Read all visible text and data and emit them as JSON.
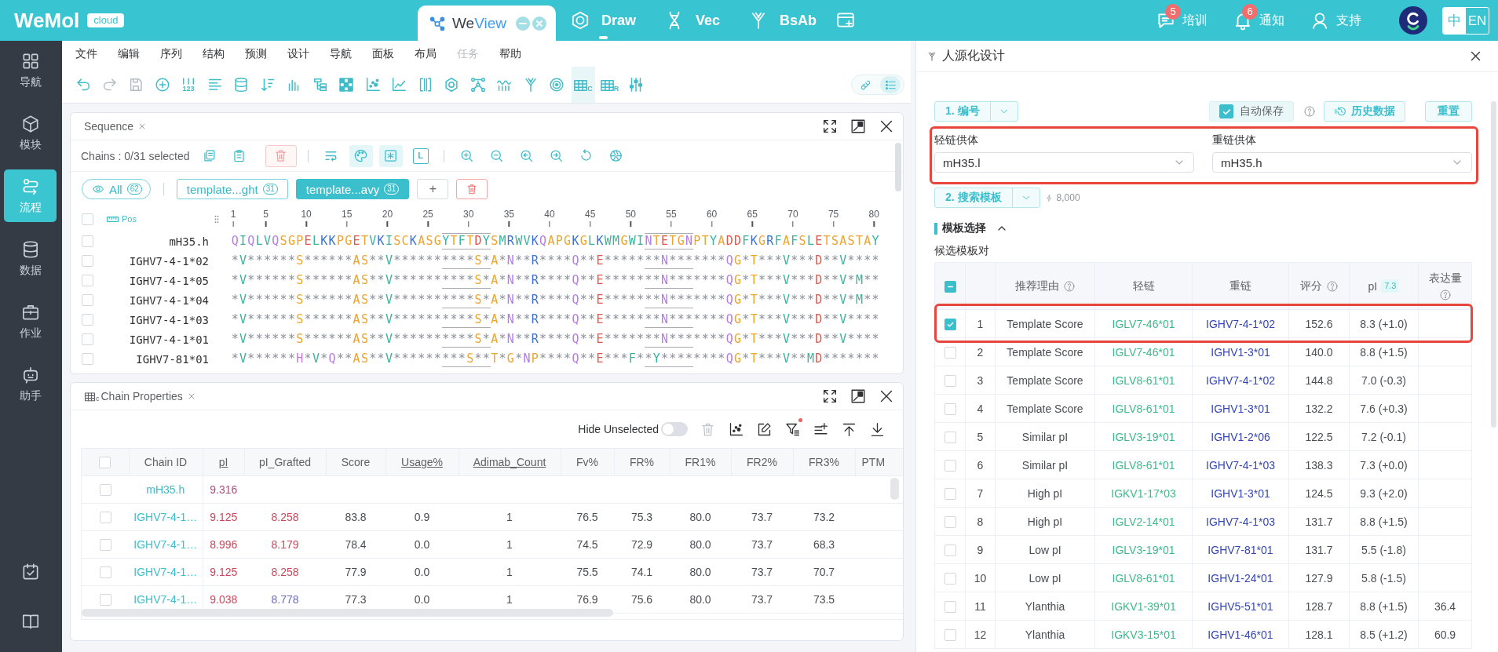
{
  "top_bar": {
    "logo": "WeMol",
    "edition": "cloud",
    "tabs": [
      {
        "label_parts": [
          "We",
          "View"
        ],
        "selected": true,
        "indicator": false
      },
      {
        "label_parts": [
          "Draw"
        ],
        "selected": false,
        "indicator": true
      },
      {
        "label_parts": [
          "Vec"
        ],
        "selected": false,
        "indicator": false
      },
      {
        "label_parts": [
          "BsAb"
        ],
        "selected": false,
        "indicator": false
      }
    ],
    "links": [
      {
        "label": "培训",
        "badge": "5"
      },
      {
        "label": "通知",
        "badge": "6"
      },
      {
        "label": "支持"
      }
    ],
    "languages": [
      {
        "label": "中",
        "selected": true
      },
      {
        "label": "EN",
        "selected": false
      }
    ]
  },
  "sidebar": {
    "items": [
      {
        "label": "导航",
        "selected": false
      },
      {
        "label": "模块",
        "selected": false
      },
      {
        "label": "流程",
        "selected": true
      },
      {
        "label": "数据",
        "selected": false
      },
      {
        "label": "作业",
        "selected": false
      },
      {
        "label": "助手",
        "selected": false
      }
    ]
  },
  "menu": [
    {
      "label": "文件",
      "disabled": false
    },
    {
      "label": "编辑",
      "disabled": false
    },
    {
      "label": "序列",
      "disabled": false
    },
    {
      "label": "结构",
      "disabled": false
    },
    {
      "label": "预测",
      "disabled": false
    },
    {
      "label": "设计",
      "disabled": false
    },
    {
      "label": "导航",
      "disabled": false
    },
    {
      "label": "面板",
      "disabled": false
    },
    {
      "label": "布局",
      "disabled": false
    },
    {
      "label": "任务",
      "disabled": true
    },
    {
      "label": "帮助",
      "disabled": false
    }
  ],
  "toolbar": {
    "tools": [
      {
        "disabled": false,
        "selected": false
      },
      {
        "disabled": true,
        "selected": false
      },
      {
        "disabled": true,
        "selected": false
      },
      {
        "disabled": false,
        "selected": false
      },
      {
        "disabled": false,
        "selected": false,
        "sub": "123"
      },
      {
        "disabled": false,
        "selected": false
      },
      {
        "disabled": false,
        "selected": false
      },
      {
        "disabled": false,
        "selected": false
      },
      {
        "disabled": false,
        "selected": false
      },
      {
        "disabled": false,
        "selected": false
      },
      {
        "disabled": false,
        "selected": false
      },
      {
        "disabled": false,
        "selected": false
      },
      {
        "disabled": false,
        "selected": false
      },
      {
        "disabled": false,
        "selected": false
      },
      {
        "disabled": false,
        "selected": false
      },
      {
        "disabled": false,
        "selected": false
      },
      {
        "disabled": false,
        "selected": false
      },
      {
        "disabled": false,
        "selected": false
      },
      {
        "disabled": false,
        "selected": false
      },
      {
        "disabled": false,
        "selected": true,
        "sub": "C"
      },
      {
        "disabled": false,
        "selected": false,
        "sub": "R"
      },
      {
        "disabled": false,
        "selected": false
      }
    ],
    "view_modes": [
      {
        "selected": false
      },
      {
        "selected": true
      }
    ]
  },
  "sequence_panel": {
    "title": "Sequence",
    "selection_info": "Chains : 0/31 selected",
    "tools": [
      {
        "kind": "icon",
        "selected": false,
        "disabled": false
      },
      {
        "kind": "icon",
        "selected": false,
        "disabled": false
      },
      {
        "kind": "danger",
        "selected": false,
        "disabled": true
      },
      {
        "kind": "icon",
        "selected": false,
        "disabled": false
      },
      {
        "kind": "icon",
        "selected": true,
        "disabled": false
      },
      {
        "kind": "icon",
        "selected": true,
        "disabled": false
      },
      {
        "kind": "letter",
        "label": "L",
        "selected": false,
        "disabled": false
      },
      {
        "kind": "icon",
        "selected": false,
        "disabled": false
      },
      {
        "kind": "icon",
        "selected": false,
        "disabled": false
      },
      {
        "kind": "icon",
        "selected": false,
        "disabled": false
      },
      {
        "kind": "icon",
        "selected": false,
        "disabled": false
      },
      {
        "kind": "icon",
        "selected": false,
        "disabled": false
      },
      {
        "kind": "icon",
        "selected": false,
        "disabled": false
      }
    ],
    "chain_groups": [
      {
        "kind": "all",
        "label": "All",
        "count": "62",
        "selected": false
      },
      {
        "kind": "group",
        "label": "template...ght",
        "count": "31",
        "selected": false
      },
      {
        "kind": "group",
        "label": "template...avy",
        "count": "31",
        "selected": true
      }
    ],
    "add_label": "+",
    "all_checked": false,
    "ruler_label": "Pos",
    "ruler_ticks": [
      "1",
      "5",
      "10",
      "15",
      "20",
      "25",
      "30",
      "35",
      "40",
      "45",
      "50",
      "55",
      "60",
      "65",
      "70",
      "75",
      "80"
    ],
    "rows": [
      {
        "name": "mH35.h",
        "checked": false,
        "segments": [
          {
            "text": "QIQLVQSGPELKKPGETVKISCKASG",
            "marked": false
          },
          {
            "text": "YTFTDY",
            "marked": true
          },
          {
            "text": "SMRWVKQAPGKGLKWMGWI",
            "marked": false
          },
          {
            "text": "NTETGN",
            "marked": true
          },
          {
            "text": "PTYADDFKGRFAFSLETSASTAY",
            "marked": false
          }
        ]
      },
      {
        "name": "IGHV7-4-1*02",
        "checked": false,
        "segments": [
          {
            "text": "*V******S******AS**V******",
            "marked": false
          },
          {
            "text": "****S*",
            "marked": true
          },
          {
            "text": "A*N**R****Q**E*****",
            "marked": false
          },
          {
            "text": "**N***",
            "marked": true
          },
          {
            "text": "****QG*T***V***D**V****",
            "marked": false
          }
        ]
      },
      {
        "name": "IGHV7-4-1*05",
        "checked": false,
        "segments": [
          {
            "text": "*V******S******AS**V******",
            "marked": false
          },
          {
            "text": "****S*",
            "marked": true
          },
          {
            "text": "A*N**R****Q**E*****",
            "marked": false
          },
          {
            "text": "**N***",
            "marked": true
          },
          {
            "text": "****QG*T***V***D**V*M**",
            "marked": false
          }
        ]
      },
      {
        "name": "IGHV7-4-1*04",
        "checked": false,
        "segments": [
          {
            "text": "*V******S******AS**V******",
            "marked": false
          },
          {
            "text": "****S*",
            "marked": true
          },
          {
            "text": "A*N**R****Q**E*****",
            "marked": false
          },
          {
            "text": "**N***",
            "marked": true
          },
          {
            "text": "****QG*T***V***D**V*M**",
            "marked": false
          }
        ]
      },
      {
        "name": "IGHV7-4-1*03",
        "checked": false,
        "segments": [
          {
            "text": "*V******S******AS**V******",
            "marked": false
          },
          {
            "text": "****S*",
            "marked": true
          },
          {
            "text": "A*N**R****Q**E*****",
            "marked": false
          },
          {
            "text": "**N***",
            "marked": true
          },
          {
            "text": "****QG*T***V***D**V****",
            "marked": false
          }
        ]
      },
      {
        "name": "IGHV7-4-1*01",
        "checked": false,
        "segments": [
          {
            "text": "*V******S******AS**V******",
            "marked": false
          },
          {
            "text": "****S*",
            "marked": true
          },
          {
            "text": "A*N**R****Q**E*****",
            "marked": false
          },
          {
            "text": "**N***",
            "marked": true
          },
          {
            "text": "****QG*T***V***D**V****",
            "marked": false
          }
        ]
      },
      {
        "name": "IGHV7-81*01",
        "checked": false,
        "segments": [
          {
            "text": "*V******H*V*Q**AS**V******",
            "marked": false
          },
          {
            "text": "***S**",
            "marked": true
          },
          {
            "text": "T*G*NP****Q**E***F*",
            "marked": false
          },
          {
            "text": "*Y****",
            "marked": true
          },
          {
            "text": "****QG*T***V**MD*******",
            "marked": false
          }
        ]
      }
    ]
  },
  "chain_properties": {
    "title": "Chain Properties",
    "title_icon_sub": "c",
    "hide_unselected": {
      "label": "Hide Unselected",
      "on": false
    },
    "tools": [
      {
        "disabled": true,
        "dot": false
      },
      {
        "disabled": false,
        "dot": false
      },
      {
        "disabled": false,
        "dot": false
      },
      {
        "disabled": false,
        "dot": true
      },
      {
        "disabled": false,
        "dot": false
      },
      {
        "disabled": false,
        "dot": false
      },
      {
        "disabled": false,
        "dot": false
      }
    ],
    "all_checked": false,
    "columns": [
      {
        "label": "Chain ID",
        "underlined": false
      },
      {
        "label": "pI",
        "underlined": true
      },
      {
        "label": "pI_Grafted",
        "underlined": false
      },
      {
        "label": "Score",
        "underlined": false
      },
      {
        "label": "Usage%",
        "underlined": true
      },
      {
        "label": "Adimab_Count",
        "underlined": true
      },
      {
        "label": "Fv%",
        "underlined": false
      },
      {
        "label": "FR%",
        "underlined": false
      },
      {
        "label": "FR1%",
        "underlined": false
      },
      {
        "label": "FR2%",
        "underlined": false
      },
      {
        "label": "FR3%",
        "underlined": false
      },
      {
        "label": "PTM",
        "underlined": false
      }
    ],
    "rows": [
      {
        "checked": false,
        "chain_id": "mH35.h",
        "pI": {
          "value": "9.316",
          "color": "#a4507e"
        }
      },
      {
        "checked": false,
        "chain_id": "IGHV7-4-1…",
        "pI": {
          "value": "9.125",
          "color": "#c8485c"
        },
        "pI_grafted": {
          "value": "8.258",
          "color": "#c8485c"
        },
        "values": [
          "83.8",
          "0.9",
          "1",
          "76.5",
          "75.3",
          "80.0",
          "73.7",
          "73.2"
        ]
      },
      {
        "checked": false,
        "chain_id": "IGHV7-4-1…",
        "pI": {
          "value": "8.996",
          "color": "#c8485c"
        },
        "pI_grafted": {
          "value": "8.179",
          "color": "#c8485c"
        },
        "values": [
          "78.4",
          "0.0",
          "1",
          "74.5",
          "72.9",
          "80.0",
          "73.7",
          "68.3"
        ]
      },
      {
        "checked": false,
        "chain_id": "IGHV7-4-1…",
        "pI": {
          "value": "9.125",
          "color": "#c8485c"
        },
        "pI_grafted": {
          "value": "8.258",
          "color": "#c8485c"
        },
        "values": [
          "77.9",
          "0.0",
          "1",
          "75.5",
          "74.1",
          "80.0",
          "73.7",
          "70.7"
        ]
      },
      {
        "checked": false,
        "chain_id": "IGHV7-4-1…",
        "pI": {
          "value": "9.038",
          "color": "#c8485c"
        },
        "pI_grafted": {
          "value": "8.778",
          "color": "#6a6cb9"
        },
        "values": [
          "77.3",
          "0.0",
          "1",
          "76.9",
          "75.6",
          "80.0",
          "73.7",
          "73.5"
        ]
      }
    ]
  },
  "design_panel": {
    "title": "人源化设计",
    "step1": "1. 编号",
    "autosave": {
      "label": "自动保存",
      "checked": true
    },
    "history": "历史数据",
    "reset": "重置",
    "donors": {
      "highlighted": true,
      "fields": [
        {
          "label": "轻链供体",
          "value": "mH35.l"
        },
        {
          "label": "重链供体",
          "value": "mH35.h"
        }
      ]
    },
    "step2": "2. 搜索模板",
    "credits": "8,000",
    "section": {
      "title": "模板选择",
      "expanded": true
    },
    "subtitle": "候选模板对",
    "table": {
      "some_checked": true,
      "columns": [
        {
          "label": "推荐理由",
          "help": true
        },
        {
          "label": "轻链",
          "help": false
        },
        {
          "label": "重链",
          "help": false
        },
        {
          "label": "评分",
          "help": true
        },
        {
          "label": "pI",
          "help": false,
          "badge": "7.3"
        },
        {
          "label": "表达量",
          "help": true
        }
      ],
      "rows": [
        {
          "index": "1",
          "reason": "Template Score",
          "light": "IGLV7-46*01",
          "heavy": "IGHV7-4-1*02",
          "score": "152.6",
          "pI": "8.3 (+1.0)",
          "selected": true,
          "highlighted": true
        },
        {
          "index": "2",
          "reason": "Template Score",
          "light": "IGLV7-46*01",
          "heavy": "IGHV1-3*01",
          "score": "140.0",
          "pI": "8.8 (+1.5)",
          "selected": false,
          "highlighted": false
        },
        {
          "index": "3",
          "reason": "Template Score",
          "light": "IGLV8-61*01",
          "heavy": "IGHV7-4-1*02",
          "score": "144.8",
          "pI": "7.0 (-0.3)",
          "selected": false,
          "highlighted": false
        },
        {
          "index": "4",
          "reason": "Template Score",
          "light": "IGLV8-61*01",
          "heavy": "IGHV1-3*01",
          "score": "132.2",
          "pI": "7.6 (+0.3)",
          "selected": false,
          "highlighted": false
        },
        {
          "index": "5",
          "reason": "Similar pI",
          "light": "IGLV3-19*01",
          "heavy": "IGHV1-2*06",
          "score": "122.5",
          "pI": "7.2 (-0.1)",
          "selected": false,
          "highlighted": false
        },
        {
          "index": "6",
          "reason": "Similar pI",
          "light": "IGLV8-61*01",
          "heavy": "IGHV7-4-1*03",
          "score": "138.3",
          "pI": "7.3 (+0.0)",
          "selected": false,
          "highlighted": false
        },
        {
          "index": "7",
          "reason": "High pI",
          "light": "IGKV1-17*03",
          "heavy": "IGHV1-3*01",
          "score": "124.5",
          "pI": "9.3 (+2.0)",
          "selected": false,
          "highlighted": false
        },
        {
          "index": "8",
          "reason": "High pI",
          "light": "IGLV2-14*01",
          "heavy": "IGHV7-4-1*03",
          "score": "131.7",
          "pI": "8.8 (+1.5)",
          "selected": false,
          "highlighted": false
        },
        {
          "index": "9",
          "reason": "Low pI",
          "light": "IGLV3-19*01",
          "heavy": "IGHV7-81*01",
          "score": "131.7",
          "pI": "5.5 (-1.8)",
          "selected": false,
          "highlighted": false
        },
        {
          "index": "10",
          "reason": "Low pI",
          "light": "IGLV8-61*01",
          "heavy": "IGHV1-24*01",
          "score": "127.9",
          "pI": "5.8 (-1.5)",
          "selected": false,
          "highlighted": false
        },
        {
          "index": "11",
          "reason": "Ylanthia",
          "light": "IGKV1-39*01",
          "heavy": "IGHV5-51*01",
          "score": "128.7",
          "pI": "8.8 (+1.5)",
          "expression": "36.4",
          "selected": false,
          "highlighted": false
        },
        {
          "index": "12",
          "reason": "Ylanthia",
          "light": "IGKV3-15*01",
          "heavy": "IGHV1-46*01",
          "score": "128.1",
          "pI": "8.5 (+1.2)",
          "expression": "60.9",
          "selected": false,
          "highlighted": false
        }
      ]
    }
  }
}
